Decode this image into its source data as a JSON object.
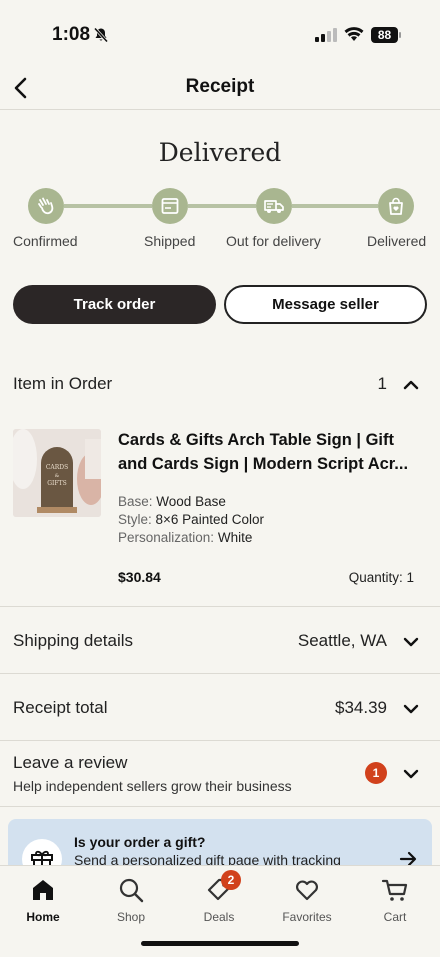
{
  "status_bar": {
    "time": "1:08",
    "battery": "88"
  },
  "header": {
    "title": "Receipt"
  },
  "order_status": {
    "heading": "Delivered",
    "steps": [
      {
        "label": "Confirmed",
        "icon": "hand-wave-icon"
      },
      {
        "label": "Shipped",
        "icon": "package-icon"
      },
      {
        "label": "Out for delivery",
        "icon": "delivery-truck-icon"
      },
      {
        "label": "Delivered",
        "icon": "heart-bag-icon"
      }
    ],
    "accent_color": "#a9b690"
  },
  "actions": {
    "track_label": "Track order",
    "message_label": "Message seller"
  },
  "items_section": {
    "label": "Item in Order",
    "count": "1"
  },
  "item": {
    "title": "Cards & Gifts Arch Table Sign | Gift and Cards Sign | Modern Script Acr...",
    "attributes": [
      {
        "key": "Base:",
        "value": "Wood Base"
      },
      {
        "key": "Style:",
        "value": "8×6 Painted Color"
      },
      {
        "key": "Personalization:",
        "value": "White"
      }
    ],
    "price": "$30.84",
    "quantity": "Quantity: 1"
  },
  "shipping": {
    "label": "Shipping details",
    "value": "Seattle, WA"
  },
  "receipt_total": {
    "label": "Receipt total",
    "value": "$34.39"
  },
  "review": {
    "label": "Leave a review",
    "sub": "Help independent sellers grow their business",
    "badge": "1"
  },
  "gift_banner": {
    "title": "Is your order a gift?",
    "sub": "Send a personalized gift page with tracking"
  },
  "tab_bar": {
    "tabs": [
      {
        "label": "Home",
        "icon": "home-icon",
        "active": true
      },
      {
        "label": "Shop",
        "icon": "search-icon"
      },
      {
        "label": "Deals",
        "icon": "tag-icon",
        "badge": "2"
      },
      {
        "label": "Favorites",
        "icon": "heart-icon"
      },
      {
        "label": "Cart",
        "icon": "cart-icon"
      }
    ]
  },
  "colors": {
    "background": "#f6f5f0",
    "badge": "#d1411c",
    "primary_button": "#2b2626",
    "gift_banner": "#d3e1ef"
  }
}
